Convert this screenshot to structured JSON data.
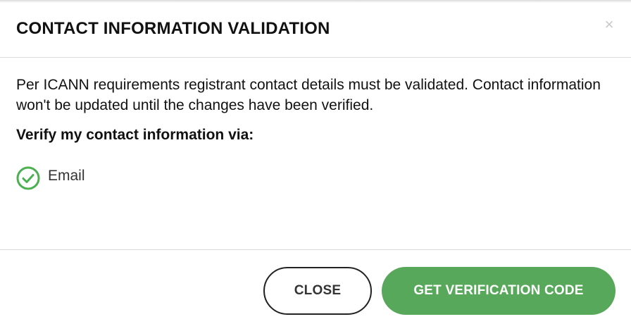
{
  "dialog": {
    "title": "CONTACT INFORMATION VALIDATION",
    "close_glyph": "×"
  },
  "body": {
    "description": "Per ICANN requirements registrant contact details must be validated. Contact information won't be updated until the changes have been verified.",
    "verify_label": "Verify my contact information via:",
    "options": [
      {
        "label": "Email",
        "selected": true,
        "icon": "check-circle-icon"
      }
    ]
  },
  "footer": {
    "close_label": "CLOSE",
    "verify_label": "GET VERIFICATION CODE"
  },
  "colors": {
    "accent_green": "#57a85a",
    "check_green": "#4caf50"
  }
}
